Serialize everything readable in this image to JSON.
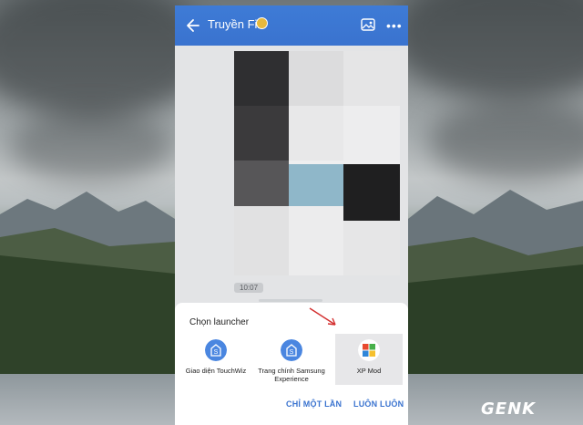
{
  "header": {
    "title": "Truyền File",
    "back_icon": "arrow-left-icon",
    "verified_icon": "verified-badge-icon",
    "gallery_icon": "image-gallery-icon",
    "more_icon": "more-horizontal-icon",
    "color": "#3a73cf"
  },
  "chat": {
    "timestamp": "10:07"
  },
  "sheet": {
    "title": "Chọn launcher",
    "apps": [
      {
        "label": "Giao diện TouchWiz",
        "icon": "launcher-app-icon",
        "selected": false
      },
      {
        "label": "Trang chính Samsung Experience",
        "icon": "launcher-app-icon",
        "selected": false
      },
      {
        "label": "XP Mod",
        "icon": "windows-xp-logo-icon",
        "selected": true
      }
    ],
    "buttons": {
      "just_once": "CHỈ MỘT LẦN",
      "always": "LUÔN LUÔN"
    }
  },
  "watermark": "GENK",
  "colors": {
    "accent": "#3a73cf",
    "arrow": "#d32f2f"
  }
}
